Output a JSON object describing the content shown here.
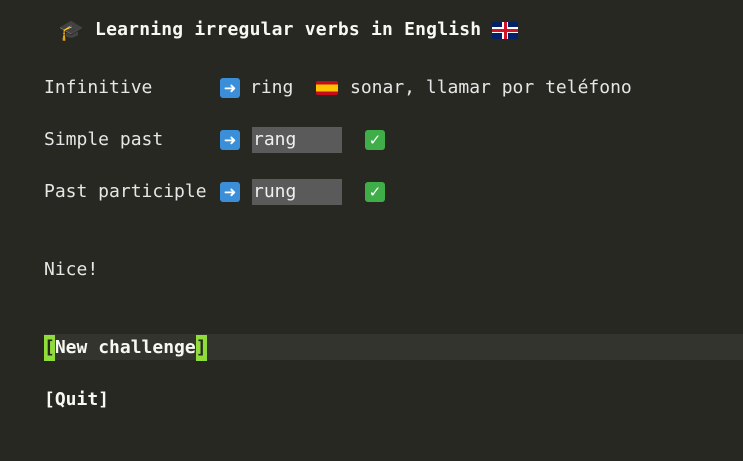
{
  "title": {
    "text": "Learning irregular verbs in English",
    "lead_icon": "graduate-icon",
    "trail_icon": "uk-flag-icon"
  },
  "infinitive": {
    "label": "Infinitive",
    "value": "ring",
    "translation": "sonar, llamar por teléfono",
    "translation_icon": "spain-flag-icon"
  },
  "simple_past": {
    "label": "Simple past",
    "value": "rang",
    "status_icon": "check-icon"
  },
  "past_participle": {
    "label": "Past participle",
    "value": "rung",
    "status_icon": "check-icon"
  },
  "feedback": "Nice!",
  "buttons": {
    "new_challenge_open": "[",
    "new_challenge": "New challenge",
    "new_challenge_close": "]",
    "quit": "[Quit]"
  },
  "colors": {
    "background": "#272822",
    "focus_bracket": "#8fdc3a",
    "input_bg": "#5a5a5a"
  }
}
